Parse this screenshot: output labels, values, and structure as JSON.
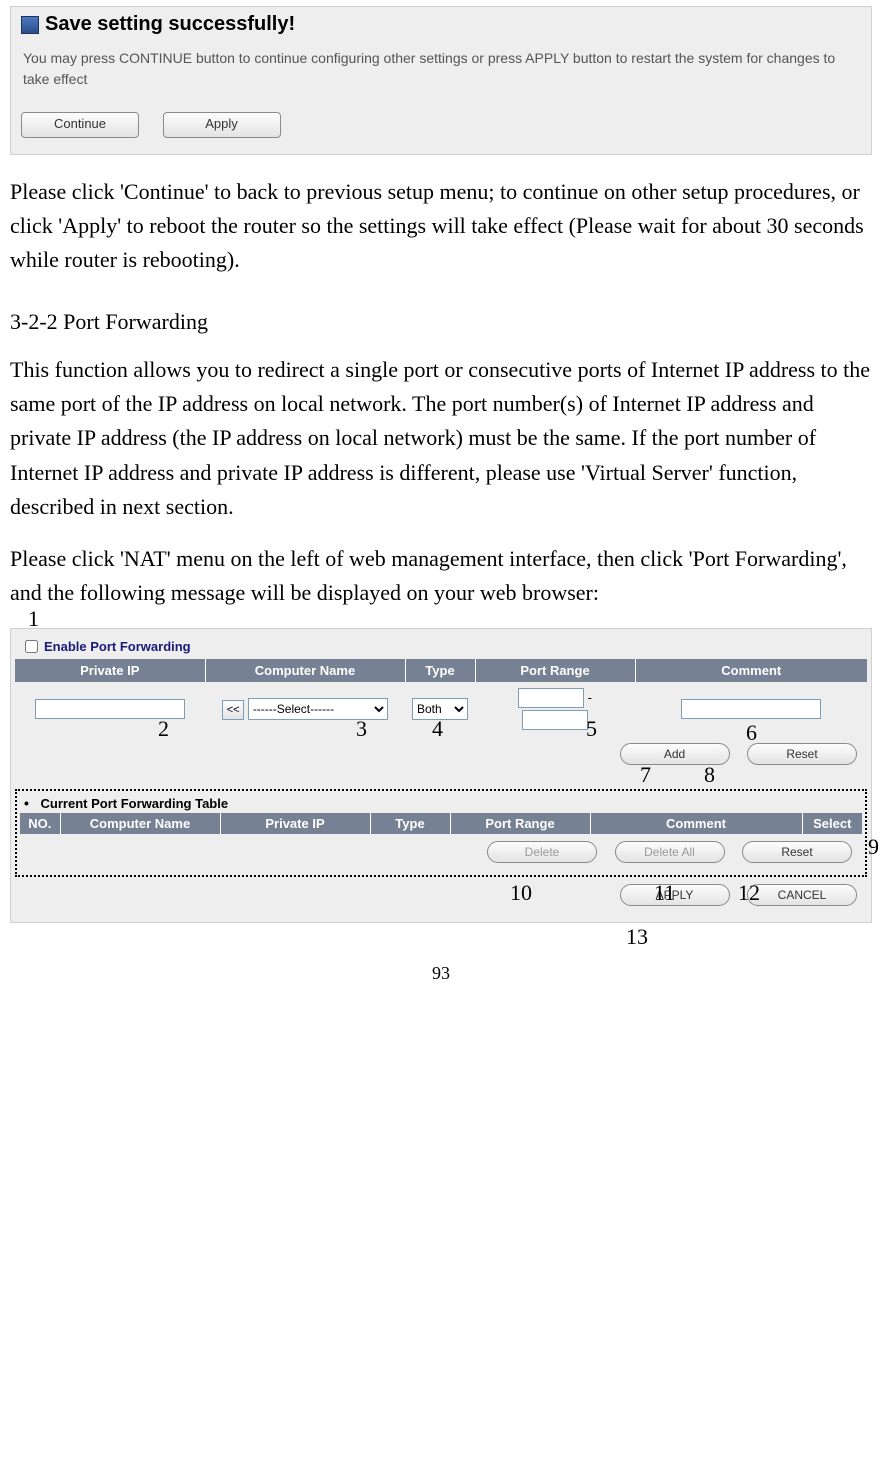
{
  "panel_save": {
    "title": "Save setting successfully!",
    "message": "You may press CONTINUE button to continue configuring other settings or press APPLY button to restart the system for changes to take effect",
    "continue_label": "Continue",
    "apply_label": "Apply"
  },
  "body": {
    "para1": "Please click 'Continue' to back to previous setup menu; to continue on other setup procedures, or click 'Apply' to reboot the router so the settings will take effect (Please wait for about 30 seconds while router is rebooting).",
    "heading": "3-2-2 Port Forwarding",
    "para2": "This function allows you to redirect a single port or consecutive ports of Internet IP address to the same port of the IP address on local network. The port number(s) of Internet IP address and private IP address (the IP address on local network) must be the same. If the port number of Internet IP address and private IP address is different, please use 'Virtual Server' function, described in next section.",
    "para3": "Please click 'NAT' menu on the left of web management interface, then click 'Port Forwarding', and the following message will be displayed on your web browser:"
  },
  "pf": {
    "enable_label": "Enable Port Forwarding",
    "input_headers": {
      "private_ip": "Private IP",
      "computer_name": "Computer Name",
      "type": "Type",
      "port_range": "Port Range",
      "comment": "Comment"
    },
    "select_button": "<<",
    "computer_select_display": "------Select------",
    "type_select_display": "Both",
    "port_dash": "-",
    "add_label": "Add",
    "reset_label": "Reset",
    "current_title": "Current Port Forwarding Table",
    "data_headers": {
      "no": "NO.",
      "computer_name": "Computer Name",
      "private_ip": "Private IP",
      "type": "Type",
      "port_range": "Port Range",
      "comment": "Comment",
      "select": "Select"
    },
    "delete_label": "Delete",
    "delete_all_label": "Delete All",
    "reset2_label": "Reset",
    "apply_label": "APPLY",
    "cancel_label": "CANCEL"
  },
  "callouts": {
    "c1": "1",
    "c2": "2",
    "c3": "3",
    "c4": "4",
    "c5": "5",
    "c6": "6",
    "c7": "7",
    "c8": "8",
    "c9": "9",
    "c10": "10",
    "c11": "11",
    "c12": "12",
    "c13": "13"
  },
  "page_number": "93"
}
